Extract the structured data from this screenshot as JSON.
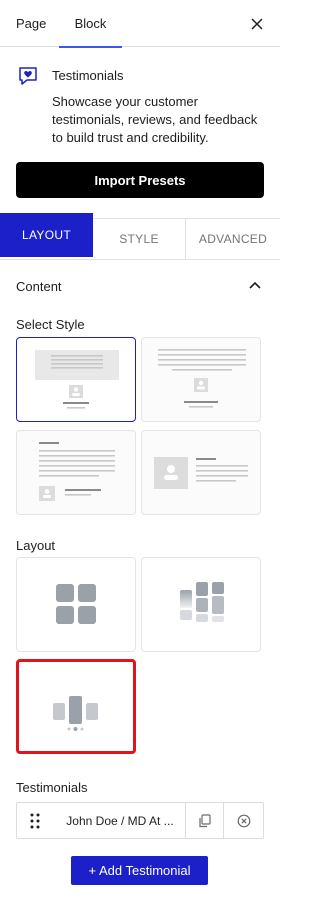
{
  "tabs": {
    "page": "Page",
    "block": "Block"
  },
  "block": {
    "icon": "heart-chat-icon",
    "title": "Testimonials",
    "description": "Showcase your customer testimonials, reviews, and feedback to build trust and credibility."
  },
  "import_button": "Import Presets",
  "panel_tabs": {
    "layout": "LAYOUT",
    "style": "STYLE",
    "advanced": "ADVANCED"
  },
  "content_section": {
    "title": "Content",
    "select_style_label": "Select Style",
    "styles": [
      {
        "id": "style-1",
        "selected": true
      },
      {
        "id": "style-2",
        "selected": false
      },
      {
        "id": "style-3",
        "selected": false
      },
      {
        "id": "style-4",
        "selected": false
      }
    ],
    "layout_label": "Layout",
    "layouts": [
      {
        "id": "grid",
        "selected": false
      },
      {
        "id": "masonry",
        "selected": false
      },
      {
        "id": "carousel",
        "selected": true
      }
    ],
    "testimonials_label": "Testimonials",
    "testimonials": [
      {
        "title": "John Doe / MD At ..."
      }
    ],
    "add_button": "+ Add Testimonial"
  },
  "colors": {
    "accent": "#1b20c8",
    "highlight": "#e0141b",
    "tab_underline": "#3858e9"
  }
}
